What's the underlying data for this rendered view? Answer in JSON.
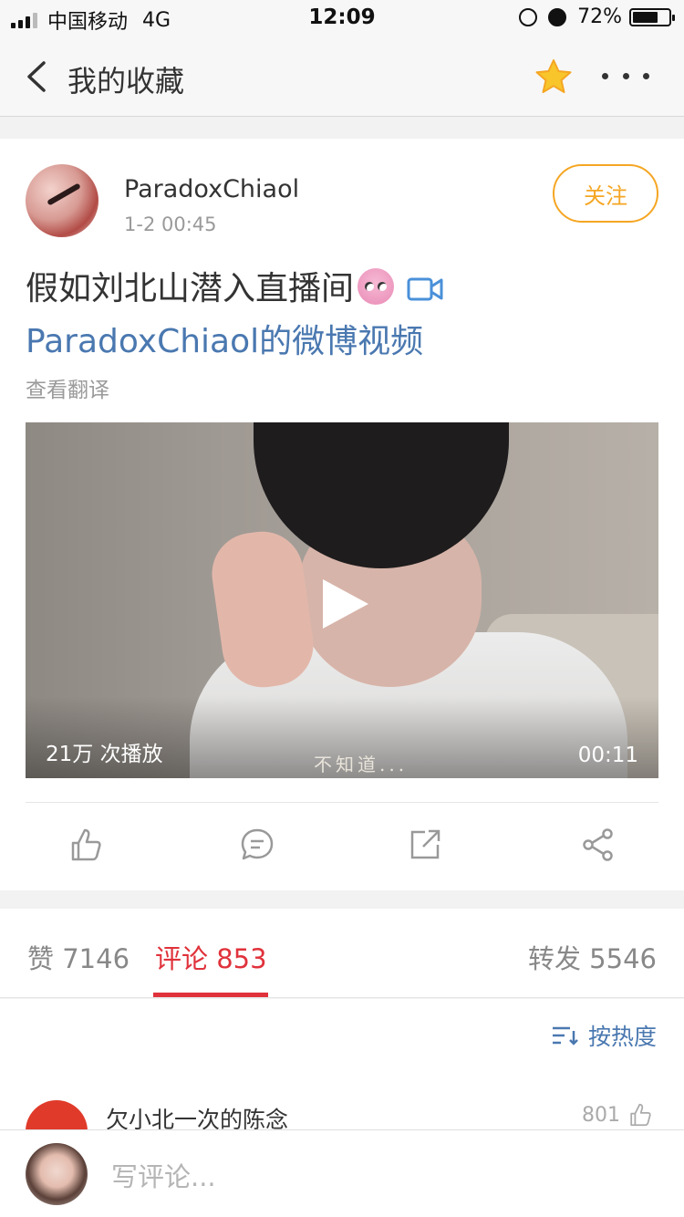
{
  "status_bar": {
    "carrier": "中国移动",
    "network": "4G",
    "time": "12:09",
    "battery": "72%",
    "battery_level": 0.72
  },
  "nav": {
    "title": "我的收藏",
    "back_icon": "chevron-left-icon",
    "star_icon": "star-icon",
    "more_icon": "more-dots-icon"
  },
  "post": {
    "username": "ParadoxChiaol",
    "time": "1-2 00:45",
    "follow_label": "关注",
    "text": "假如刘北山潜入直播间",
    "link": "ParadoxChiaol的微博视频",
    "translate": "查看翻译",
    "video": {
      "plays": "21万 次播放",
      "duration": "00:11",
      "subtitle": "不知道..."
    }
  },
  "stats": {
    "likes": "赞 7146",
    "comments": "评论 853",
    "reposts": "转发 5546"
  },
  "sort_label": "按热度",
  "comment": {
    "name": "欠小北一次的陈念",
    "likes": "801"
  },
  "bottom": {
    "placeholder": "写评论..."
  },
  "colors": {
    "accent_orange": "#f5a623",
    "link_blue": "#4a78b0",
    "active_red": "#e0323b"
  }
}
